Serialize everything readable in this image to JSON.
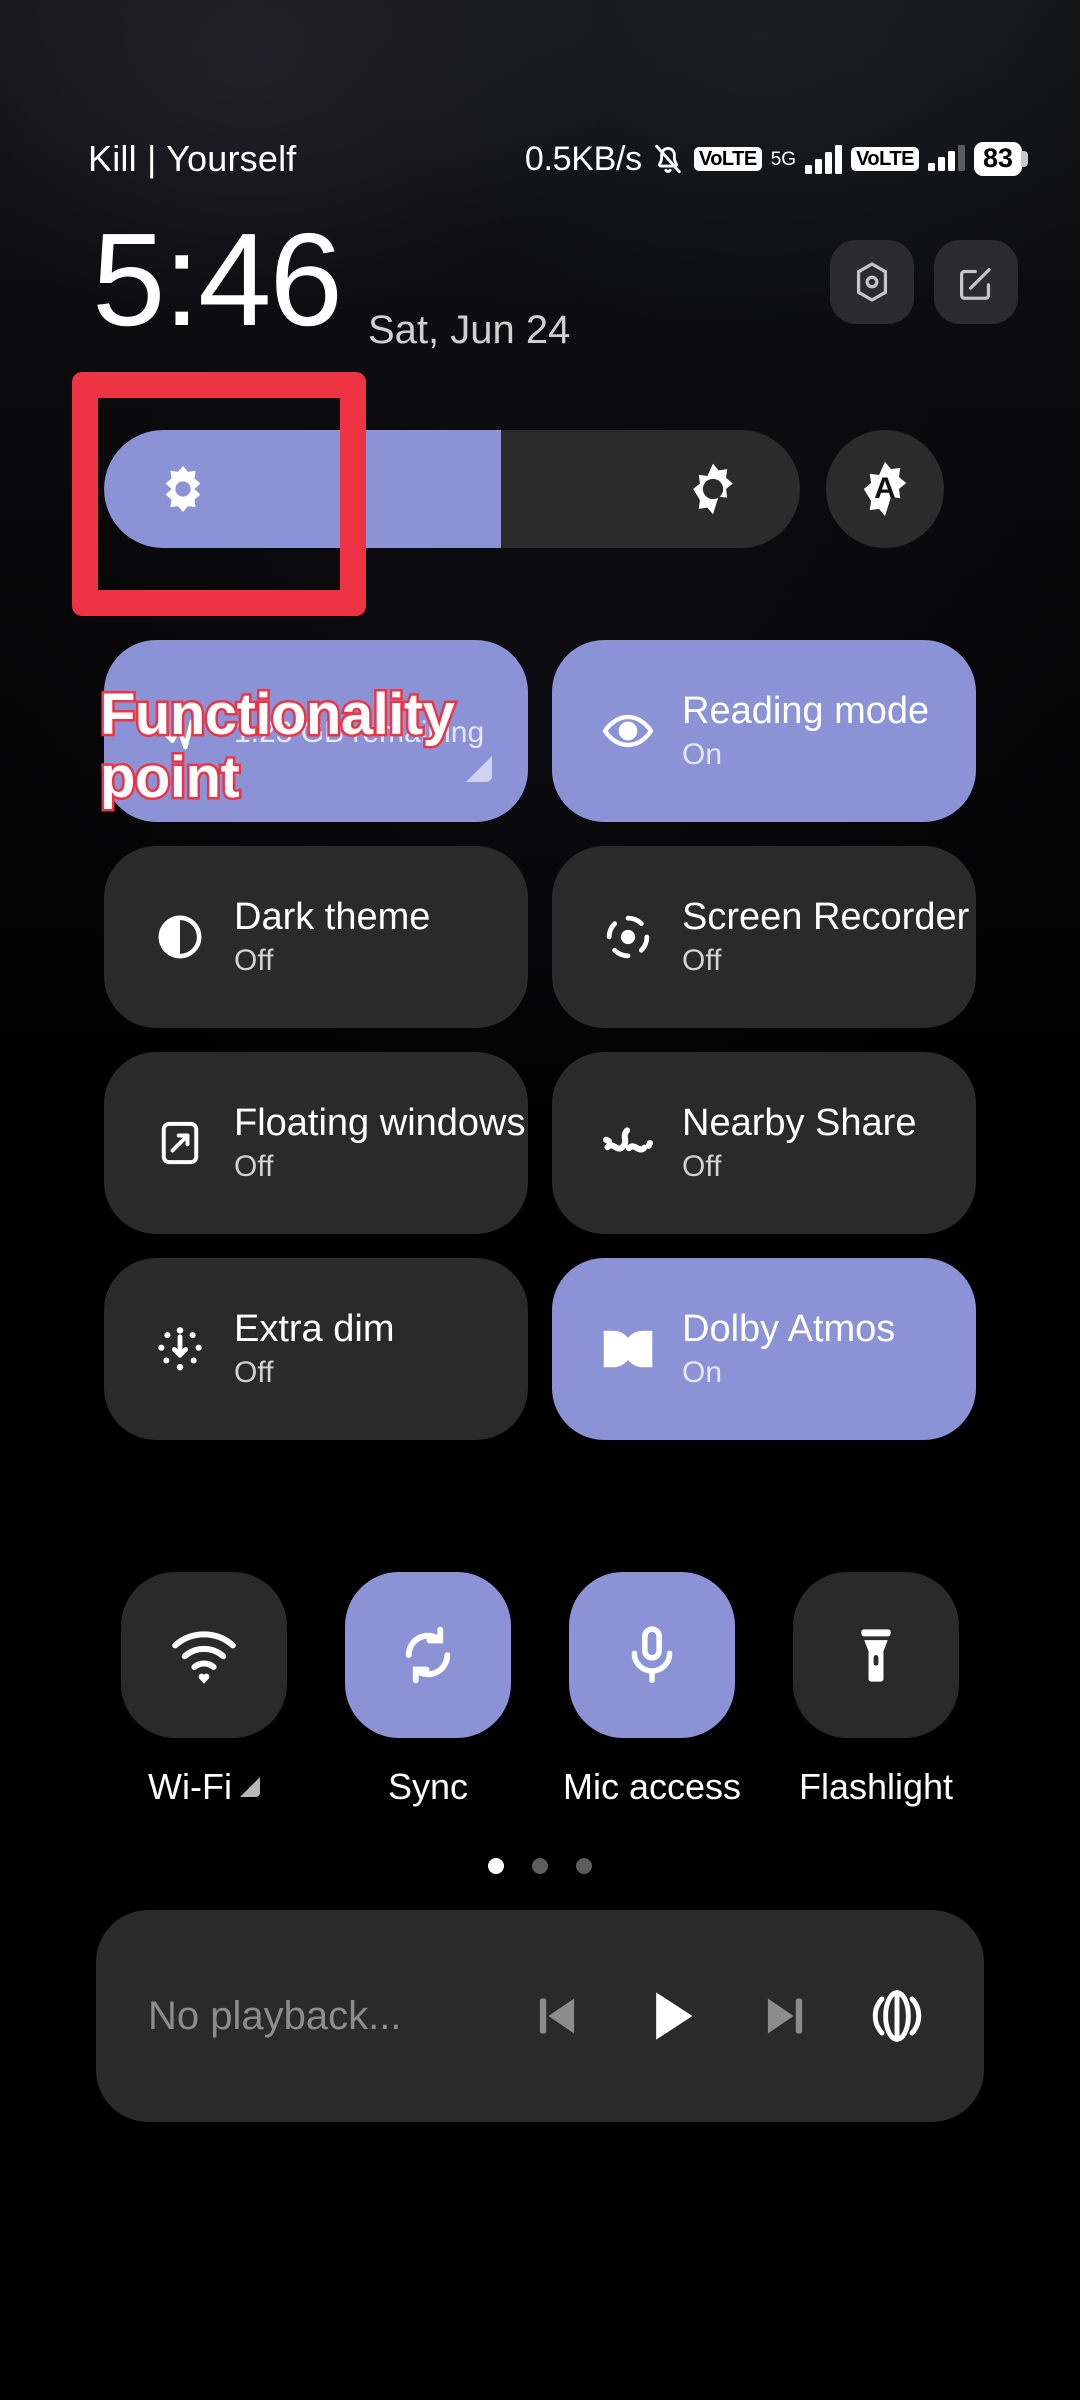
{
  "theme": {
    "accent": "#8b92d6",
    "tile_off_bg": "#2a2a2a",
    "annotation_red": "#ee3344",
    "background": "#000000"
  },
  "statusbar": {
    "carrier": "Kill | Yourself",
    "network_speed": "0.5KB/s",
    "mute_icon": "bell-mute-icon",
    "volte_badge_1": "VoLTE",
    "network_gen": "5G",
    "volte_badge_2": "VoLTE",
    "battery_percent": "83"
  },
  "header": {
    "time": "5:46",
    "date": "Sat, Jun 24",
    "settings_icon": "settings-hexagon-icon",
    "edit_icon": "edit-pencil-icon"
  },
  "brightness": {
    "low_icon": "brightness-low-icon",
    "high_icon": "brightness-high-icon",
    "auto_label": "A",
    "fill_percent": "57"
  },
  "annotation": {
    "box_label": "brightness-slider-highlight",
    "text": "Functionality point"
  },
  "tiles": [
    {
      "title": "",
      "subtitle": "1.23 GB remaining",
      "icon": "mobile-data-icon",
      "state": "on",
      "has_expand": true,
      "name": "tile-mobile-data"
    },
    {
      "title": "Reading mode",
      "subtitle": "On",
      "icon": "eye-icon",
      "state": "on",
      "has_expand": false,
      "name": "tile-reading-mode"
    },
    {
      "title": "Dark theme",
      "subtitle": "Off",
      "icon": "half-circle-icon",
      "state": "off",
      "has_expand": false,
      "name": "tile-dark-theme"
    },
    {
      "title": "Screen Recorder",
      "subtitle": "Off",
      "icon": "record-icon",
      "state": "off",
      "has_expand": false,
      "name": "tile-screen-recorder"
    },
    {
      "title": "Floating windows",
      "subtitle": "Off",
      "icon": "floating-window-icon",
      "state": "off",
      "has_expand": false,
      "name": "tile-floating-windows"
    },
    {
      "title": "Nearby Share",
      "subtitle": "Off",
      "icon": "nearby-share-icon",
      "state": "off",
      "has_expand": false,
      "name": "tile-nearby-share"
    },
    {
      "title": "Extra dim",
      "subtitle": "Off",
      "icon": "extra-dim-icon",
      "state": "off",
      "has_expand": false,
      "name": "tile-extra-dim"
    },
    {
      "title": "Dolby Atmos",
      "subtitle": "On",
      "icon": "dolby-icon",
      "state": "on",
      "has_expand": false,
      "name": "tile-dolby-atmos"
    }
  ],
  "quick_toggles": [
    {
      "label": "Wi-Fi",
      "icon": "wifi-icon",
      "state": "off",
      "has_arrow": true,
      "name": "quick-toggle-wifi"
    },
    {
      "label": "Sync",
      "icon": "sync-icon",
      "state": "on",
      "has_arrow": false,
      "name": "quick-toggle-sync"
    },
    {
      "label": "Mic access",
      "icon": "microphone-icon",
      "state": "on",
      "has_arrow": false,
      "name": "quick-toggle-mic-access"
    },
    {
      "label": "Flashlight",
      "icon": "flashlight-icon",
      "state": "off",
      "has_arrow": false,
      "name": "quick-toggle-flashlight"
    }
  ],
  "page_dots": {
    "total": 3,
    "active_index": 0
  },
  "media_player": {
    "status_text": "No playback...",
    "prev_icon": "skip-previous-icon",
    "play_icon": "play-icon",
    "next_icon": "skip-next-icon",
    "cast_icon": "cast-output-icon"
  }
}
